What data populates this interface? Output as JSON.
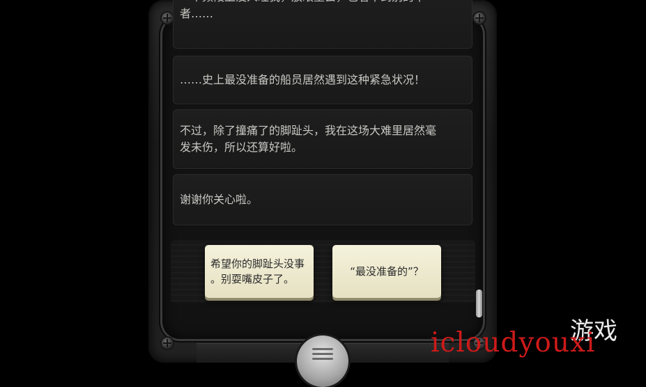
{
  "messages": {
    "cut_top_line1": "一个频段上没人理我，放眼望去，也看不到别的幸",
    "cut_top_line2": "者……",
    "msg1": "……史上最没准备的船员居然遇到这种紧急状况！",
    "msg2_line1": "不过，除了撞痛了的脚趾头，我在这场大难里居然毫",
    "msg2_line2": "发未伤，所以还算好啦。",
    "msg3": "谢谢你关心啦。"
  },
  "choices": {
    "left_line1": "希望你的脚趾头没事",
    "left_line2": "。别耍嘴皮子了。",
    "right": "“最没准备的”？"
  },
  "watermark": {
    "text": "icloudyouxi",
    "logo": "游戏"
  },
  "colors": {
    "choice_bg": "#f0ecd2",
    "text_light": "#c8c8c4",
    "watermark": "#cc1a1a"
  },
  "icons": [
    "menu-icon",
    "screw-icon",
    "scrollbar-thumb"
  ]
}
